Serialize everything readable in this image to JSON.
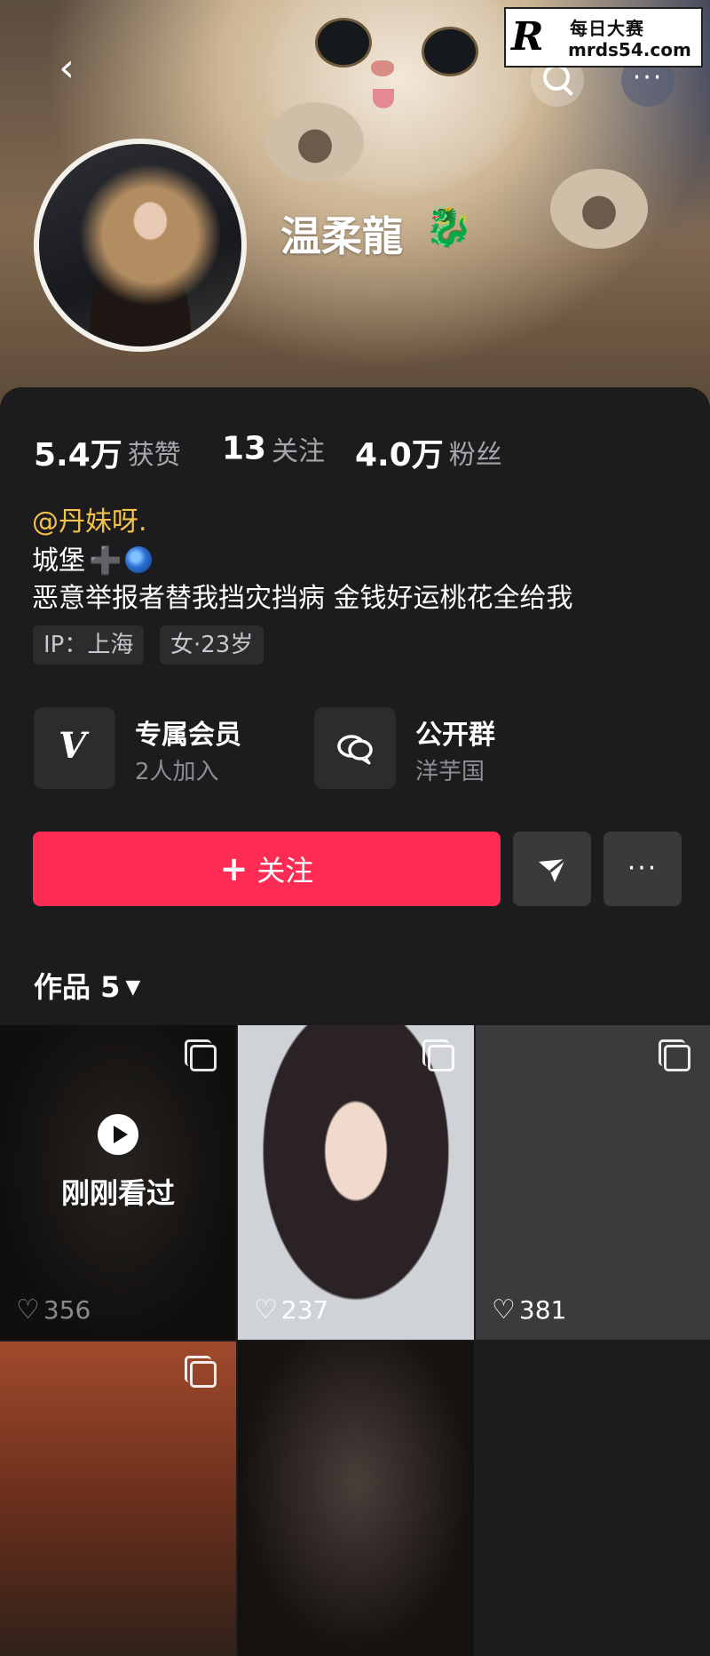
{
  "watermark": {
    "logo": "R",
    "title": "每日大赛",
    "url": "mrds54.com"
  },
  "header": {
    "back_icon": "chevron-left-icon",
    "search_icon": "search-icon",
    "more_label": "···"
  },
  "profile": {
    "nickname": "温柔龍",
    "nickname_emoji": "🐉"
  },
  "stats": [
    {
      "value": "5.4万",
      "label": "获赞"
    },
    {
      "value": "13",
      "label": "关注"
    },
    {
      "value": "4.0万",
      "label": "粉丝"
    }
  ],
  "bio": {
    "mention": "@丹妹呀.",
    "line1": "城堡",
    "line1_plus": "➕",
    "line2": "恶意举报者替我挡灾挡病  金钱好运桃花全给我"
  },
  "tags": [
    "IP：上海",
    "女·23岁"
  ],
  "features": [
    {
      "title": "专属会员",
      "subtitle": "2人加入",
      "icon": "v-logo-icon"
    },
    {
      "title": "公开群",
      "subtitle": "洋芋国",
      "icon": "group-chat-icon"
    }
  ],
  "actions": {
    "follow_plus": "+",
    "follow_label": "关注",
    "message_icon": "send-icon",
    "more_label": "···"
  },
  "works": {
    "tab_label": "作品 5",
    "caret": "▼"
  },
  "grid": [
    {
      "likes": "356",
      "overlay": "刚刚看过",
      "multi": true
    },
    {
      "likes": "237",
      "multi": true
    },
    {
      "likes": "381",
      "multi": true
    },
    {
      "likes": "",
      "multi": true
    },
    {
      "likes": "",
      "multi": false
    }
  ],
  "colors": {
    "accent": "#fe2c55",
    "mention": "#f2c24a",
    "background": "#1c1c1e"
  }
}
